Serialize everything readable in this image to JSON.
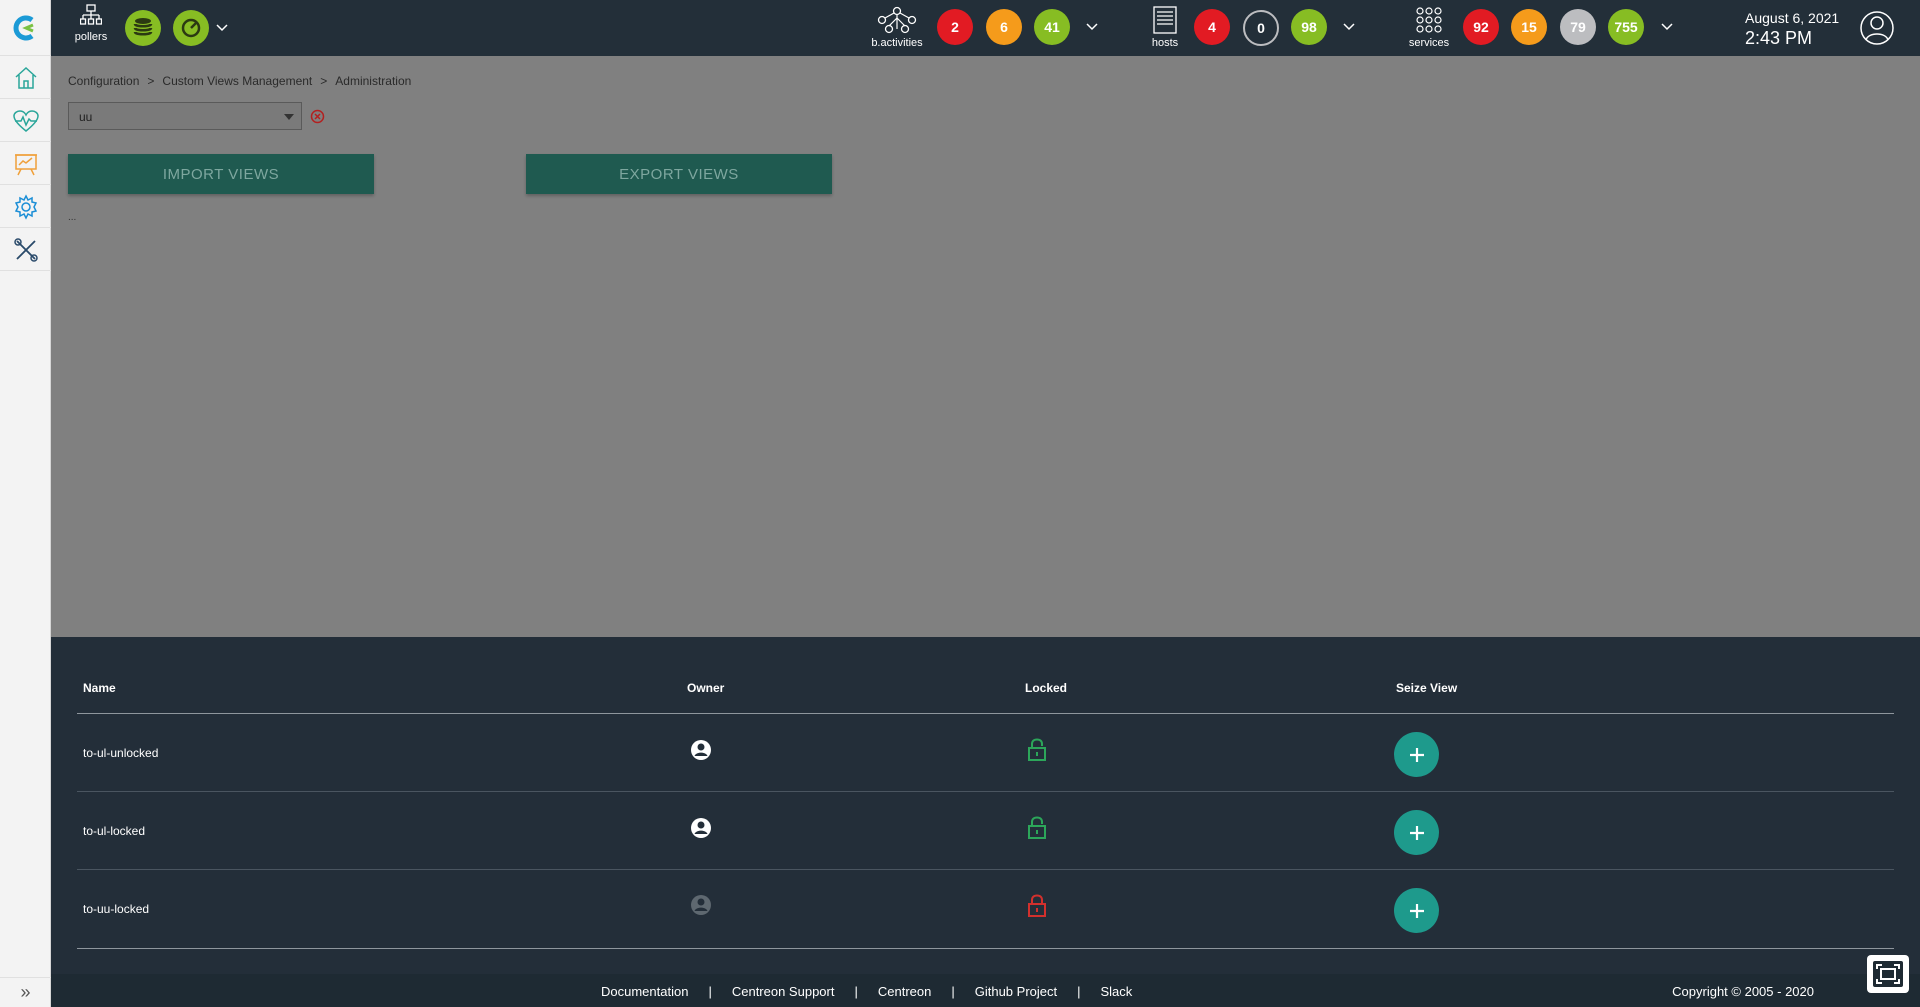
{
  "topbar": {
    "pollers_label": "pollers",
    "bactivities_label": "b.activities",
    "bactivities_counts": [
      "2",
      "6",
      "41"
    ],
    "hosts_label": "hosts",
    "hosts_counts": [
      "4",
      "0",
      "98"
    ],
    "services_label": "services",
    "services_counts": [
      "92",
      "15",
      "79",
      "755"
    ],
    "date": "August 6, 2021",
    "time": "2:43 PM"
  },
  "breadcrumb": [
    "Configuration",
    "Custom Views Management",
    "Administration"
  ],
  "breadcrumb_sep": ">",
  "filter": {
    "value": "uu"
  },
  "buttons": {
    "import": "IMPORT VIEWS",
    "export": "EXPORT VIEWS"
  },
  "dots": "...",
  "table": {
    "headers": {
      "name": "Name",
      "owner": "Owner",
      "locked": "Locked",
      "seize": "Seize View"
    },
    "rows": [
      {
        "name": "to-ul-unlocked",
        "owner_state": "active",
        "locked": false
      },
      {
        "name": "to-ul-locked",
        "owner_state": "active",
        "locked": false
      },
      {
        "name": "to-uu-locked",
        "owner_state": "inactive",
        "locked": true
      }
    ]
  },
  "footer": {
    "links": [
      "Documentation",
      "Centreon Support",
      "Centreon",
      "Github Project",
      "Slack"
    ],
    "pipe": "|",
    "copyright": "Copyright © 2005 - 2020"
  },
  "colors": {
    "critical": "#e21b23",
    "warning": "#f59b1b",
    "ok": "#87bd23",
    "unknown": "#bcbdc0",
    "teal": "#1e9a8c",
    "lock_green": "#2ca65a",
    "lock_red": "#d2302d"
  }
}
